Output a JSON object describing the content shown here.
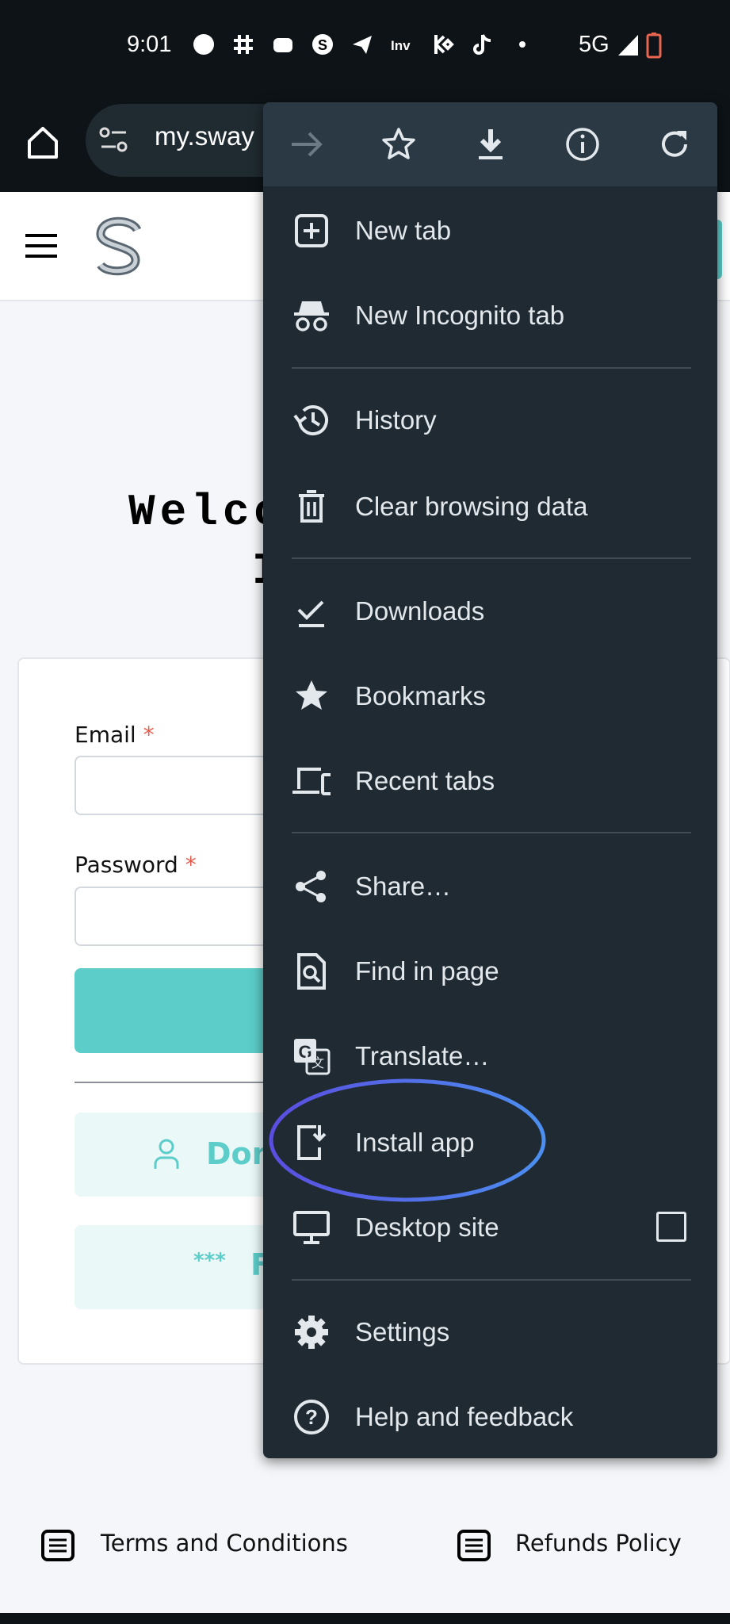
{
  "status_bar": {
    "time": "9:01",
    "network": "5G",
    "notification_icons": [
      "messenger-icon",
      "slack-icon",
      "discord-icon",
      "skype-icon",
      "telegram-icon",
      "invideo-icon",
      "kucoin-icon",
      "tiktok-icon",
      "dot-icon"
    ],
    "battery_color": "#e8654f"
  },
  "browser": {
    "url": "my.sway"
  },
  "page": {
    "welcome_line1": "Welco",
    "welcome_line2": "I",
    "email_label": "Email",
    "password_label": "Password",
    "required_mark": "*",
    "button_dont": "Don",
    "button_f": "F",
    "password_dots": "***",
    "footer": {
      "terms": "Terms and Conditions",
      "refunds": "Refunds Policy"
    },
    "accent": "#5ccdc9"
  },
  "menu": {
    "top_icons": [
      "forward-icon",
      "bookmark-star-icon",
      "download-icon",
      "info-icon",
      "reload-icon"
    ],
    "items": [
      {
        "label": "New tab"
      },
      {
        "label": "New Incognito tab"
      },
      {
        "label": "History"
      },
      {
        "label": "Clear browsing data"
      },
      {
        "label": "Downloads"
      },
      {
        "label": "Bookmarks"
      },
      {
        "label": "Recent tabs"
      },
      {
        "label": "Share…"
      },
      {
        "label": "Find in page"
      },
      {
        "label": "Translate…"
      },
      {
        "label": "Install app"
      },
      {
        "label": "Desktop site",
        "checked": false
      },
      {
        "label": "Settings"
      },
      {
        "label": "Help and feedback"
      }
    ],
    "highlight": "Install app"
  }
}
